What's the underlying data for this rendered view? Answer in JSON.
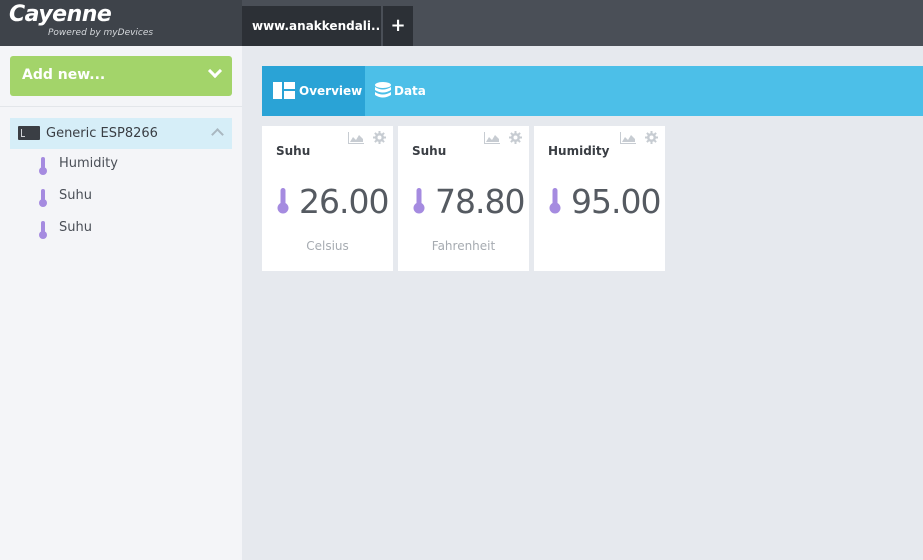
{
  "topbar": {
    "logo_name": "Cayenne",
    "logo_sub": "Powered by myDevices",
    "project_tab": "www.anakkendali...",
    "add_tab_icon": "+"
  },
  "sidebar": {
    "add_new_label": "Add new...",
    "device": {
      "label": "Generic ESP8266",
      "icon": "board-icon"
    },
    "sensors": [
      {
        "label": "Humidity",
        "icon": "thermometer-icon"
      },
      {
        "label": "Suhu",
        "icon": "thermometer-icon"
      },
      {
        "label": "Suhu",
        "icon": "thermometer-icon"
      }
    ]
  },
  "tabs": [
    {
      "label": "Overview",
      "icon": "dashboard-icon",
      "active": true
    },
    {
      "label": "Data",
      "icon": "database-icon",
      "active": false
    }
  ],
  "widgets": [
    {
      "title": "Suhu",
      "value": "26.00",
      "unit": "Celsius"
    },
    {
      "title": "Suhu",
      "value": "78.80",
      "unit": "Fahrenheit"
    },
    {
      "title": "Humidity",
      "value": "95.00",
      "unit": ""
    }
  ],
  "colors": {
    "topbar": "#4a4f57",
    "accent_green": "#a3d46a",
    "tab_blue": "#4cbfe8",
    "tab_active": "#2aa3d6",
    "thermometer": "#a58be0"
  }
}
